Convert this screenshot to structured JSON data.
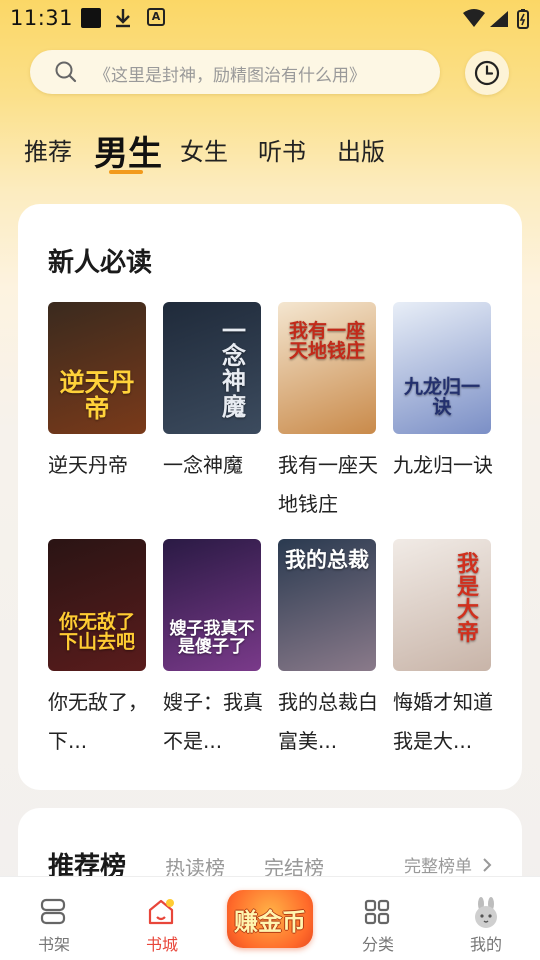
{
  "status_bar": {
    "time": "11:31"
  },
  "search": {
    "placeholder": "《这里是封神，励精图治有什么用》"
  },
  "tabs": [
    {
      "label": "推荐",
      "active": false
    },
    {
      "label": "男生",
      "active": true
    },
    {
      "label": "女生",
      "active": false
    },
    {
      "label": "听书",
      "active": false
    },
    {
      "label": "出版",
      "active": false
    }
  ],
  "section": {
    "title": "新人必读",
    "books": [
      {
        "title": "逆天丹帝",
        "cover_text": "逆天丹帝",
        "cover_colors": [
          "#3a2a1e",
          "#7a3a1a"
        ],
        "text_color": "#ffd23a"
      },
      {
        "title": "一念神魔",
        "cover_text": "一念神魔",
        "cover_colors": [
          "#1f2a3a",
          "#3c4b5e"
        ],
        "text_color": "#e8ecf2"
      },
      {
        "title": "我有一座天地钱庄",
        "cover_text": "我有一座天地钱庄",
        "cover_colors": [
          "#f4e6d0",
          "#c98a4a"
        ],
        "text_color": "#c22a1a"
      },
      {
        "title": "九龙归一诀",
        "cover_text": "九龙归一诀",
        "cover_colors": [
          "#e8eef7",
          "#7b8fc6"
        ],
        "text_color": "#23306e"
      },
      {
        "title": "你无敌了，下...",
        "cover_text": "你无敌了下山去吧",
        "cover_colors": [
          "#2a1414",
          "#5a1c1c"
        ],
        "text_color": "#ffcc33"
      },
      {
        "title": "嫂子：我真不是...",
        "cover_text": "嫂子我真不是傻子了",
        "cover_colors": [
          "#2a1a44",
          "#7a3a8a"
        ],
        "text_color": "#ffffff"
      },
      {
        "title": "我的总裁白富美...",
        "cover_text": "我的总裁",
        "cover_colors": [
          "#2a3a50",
          "#8a7a8a"
        ],
        "text_color": "#ffffff"
      },
      {
        "title": "悔婚才知道我是大...",
        "cover_text": "我是大帝",
        "cover_colors": [
          "#f1ebe6",
          "#c8b4a8"
        ],
        "text_color": "#d0301e"
      }
    ]
  },
  "ranking": {
    "title": "推荐榜",
    "tabs": [
      "热读榜",
      "完结榜"
    ],
    "more": "完整榜单"
  },
  "bottom_nav": [
    {
      "label": "书架",
      "icon": "bookshelf-icon",
      "active": false
    },
    {
      "label": "书城",
      "icon": "bookstore-icon",
      "active": true
    },
    {
      "label": "赚金币",
      "icon": "coin-icon",
      "active": false
    },
    {
      "label": "分类",
      "icon": "category-icon",
      "active": false
    },
    {
      "label": "我的",
      "icon": "profile-icon",
      "active": false
    }
  ],
  "colors": {
    "accent": "#f29a1c",
    "active_nav": "#e8463a"
  }
}
